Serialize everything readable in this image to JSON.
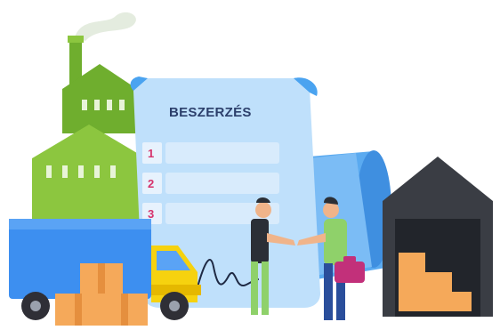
{
  "document": {
    "title": "BESZERZÉS",
    "steps": [
      "1",
      "2",
      "3"
    ]
  },
  "colors": {
    "factory_green": "#8cc63f",
    "factory_green_dark": "#6fae2e",
    "document_blue": "#bfe0fb",
    "document_accent": "#4aa3f0",
    "truck_blue": "#3d8ff0",
    "truck_cab": "#f6d20f",
    "box_orange": "#f5a95a",
    "warehouse_dark": "#3a3d44",
    "briefcase": "#c2307a",
    "man_left_shirt": "#2b2f36",
    "man_right_shirt": "#8fd16a",
    "smoke": "#e4ecdf"
  },
  "icons": {
    "factory": "factory-icon",
    "truck": "truck-icon",
    "warehouse": "warehouse-icon",
    "briefcase": "briefcase-icon",
    "signature": "signature-icon"
  }
}
